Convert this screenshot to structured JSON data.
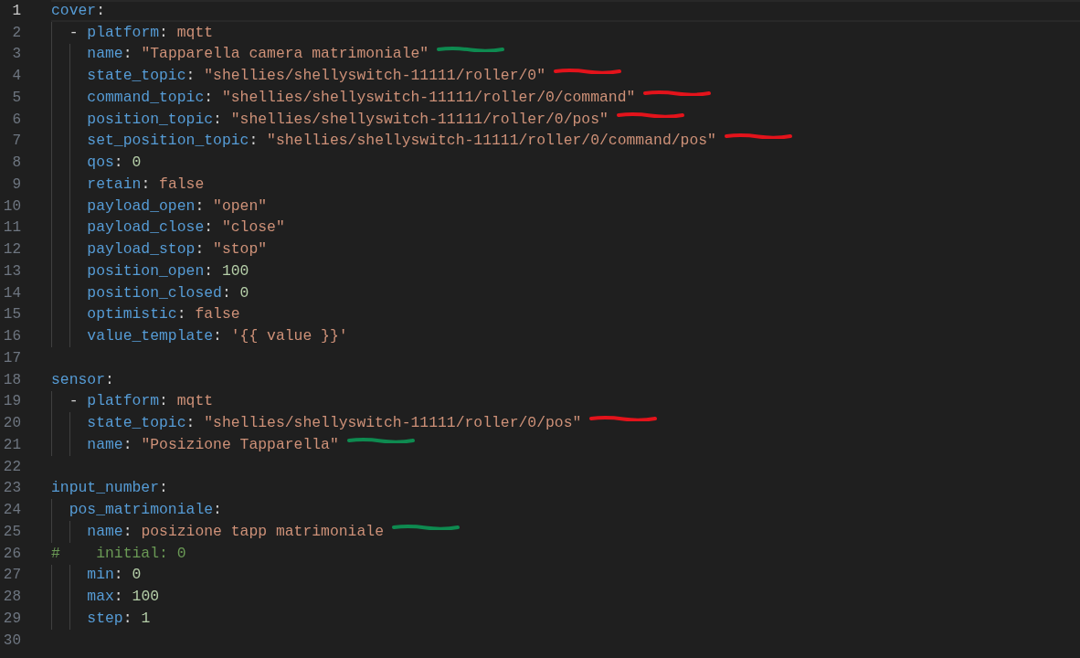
{
  "editor": {
    "lines": [
      {
        "number": "1",
        "current": true,
        "tokens": [
          {
            "kind": "key",
            "text": "cover"
          },
          {
            "kind": "punct",
            "text": ":"
          }
        ]
      },
      {
        "number": "2",
        "current": false,
        "tokens": [
          {
            "kind": "punct",
            "text": "  - "
          },
          {
            "kind": "key",
            "text": "platform"
          },
          {
            "kind": "punct",
            "text": ": "
          },
          {
            "kind": "string",
            "text": "mqtt"
          }
        ]
      },
      {
        "number": "3",
        "current": false,
        "mark": {
          "color": "#0e8a50"
        },
        "tokens": [
          {
            "kind": "key",
            "text": "    name"
          },
          {
            "kind": "punct",
            "text": ": "
          },
          {
            "kind": "string",
            "text": "\"Tapparella camera matrimoniale\""
          }
        ]
      },
      {
        "number": "4",
        "current": false,
        "mark": {
          "color": "#e3131b"
        },
        "tokens": [
          {
            "kind": "key",
            "text": "    state_topic"
          },
          {
            "kind": "punct",
            "text": ": "
          },
          {
            "kind": "string",
            "text": "\"shellies/shellyswitch-11111/roller/0\""
          }
        ]
      },
      {
        "number": "5",
        "current": false,
        "mark": {
          "color": "#e3131b"
        },
        "tokens": [
          {
            "kind": "key",
            "text": "    command_topic"
          },
          {
            "kind": "punct",
            "text": ": "
          },
          {
            "kind": "string",
            "text": "\"shellies/shellyswitch-11111/roller/0/command\""
          }
        ]
      },
      {
        "number": "6",
        "current": false,
        "mark": {
          "color": "#e3131b"
        },
        "tokens": [
          {
            "kind": "key",
            "text": "    position_topic"
          },
          {
            "kind": "punct",
            "text": ": "
          },
          {
            "kind": "string",
            "text": "\"shellies/shellyswitch-11111/roller/0/pos\""
          }
        ]
      },
      {
        "number": "7",
        "current": false,
        "mark": {
          "color": "#e3131b"
        },
        "tokens": [
          {
            "kind": "key",
            "text": "    set_position_topic"
          },
          {
            "kind": "punct",
            "text": ": "
          },
          {
            "kind": "string",
            "text": "\"shellies/shellyswitch-11111/roller/0/command/pos\""
          }
        ]
      },
      {
        "number": "8",
        "current": false,
        "tokens": [
          {
            "kind": "key",
            "text": "    qos"
          },
          {
            "kind": "punct",
            "text": ": "
          },
          {
            "kind": "number",
            "text": "0"
          }
        ]
      },
      {
        "number": "9",
        "current": false,
        "tokens": [
          {
            "kind": "key",
            "text": "    retain"
          },
          {
            "kind": "punct",
            "text": ": "
          },
          {
            "kind": "string",
            "text": "false"
          }
        ]
      },
      {
        "number": "10",
        "current": false,
        "tokens": [
          {
            "kind": "key",
            "text": "    payload_open"
          },
          {
            "kind": "punct",
            "text": ": "
          },
          {
            "kind": "string",
            "text": "\"open\""
          }
        ]
      },
      {
        "number": "11",
        "current": false,
        "tokens": [
          {
            "kind": "key",
            "text": "    payload_close"
          },
          {
            "kind": "punct",
            "text": ": "
          },
          {
            "kind": "string",
            "text": "\"close\""
          }
        ]
      },
      {
        "number": "12",
        "current": false,
        "tokens": [
          {
            "kind": "key",
            "text": "    payload_stop"
          },
          {
            "kind": "punct",
            "text": ": "
          },
          {
            "kind": "string",
            "text": "\"stop\""
          }
        ]
      },
      {
        "number": "13",
        "current": false,
        "tokens": [
          {
            "kind": "key",
            "text": "    position_open"
          },
          {
            "kind": "punct",
            "text": ": "
          },
          {
            "kind": "number",
            "text": "100"
          }
        ]
      },
      {
        "number": "14",
        "current": false,
        "tokens": [
          {
            "kind": "key",
            "text": "    position_closed"
          },
          {
            "kind": "punct",
            "text": ": "
          },
          {
            "kind": "number",
            "text": "0"
          }
        ]
      },
      {
        "number": "15",
        "current": false,
        "tokens": [
          {
            "kind": "key",
            "text": "    optimistic"
          },
          {
            "kind": "punct",
            "text": ": "
          },
          {
            "kind": "string",
            "text": "false"
          }
        ]
      },
      {
        "number": "16",
        "current": false,
        "tokens": [
          {
            "kind": "key",
            "text": "    value_template"
          },
          {
            "kind": "punct",
            "text": ": "
          },
          {
            "kind": "string",
            "text": "'{{ value }}'"
          }
        ]
      },
      {
        "number": "17",
        "current": false
      },
      {
        "number": "18",
        "current": false,
        "tokens": [
          {
            "kind": "key",
            "text": "sensor"
          },
          {
            "kind": "punct",
            "text": ":"
          }
        ]
      },
      {
        "number": "19",
        "current": false,
        "tokens": [
          {
            "kind": "punct",
            "text": "  - "
          },
          {
            "kind": "key",
            "text": "platform"
          },
          {
            "kind": "punct",
            "text": ": "
          },
          {
            "kind": "string",
            "text": "mqtt"
          }
        ]
      },
      {
        "number": "20",
        "current": false,
        "mark": {
          "color": "#e3131b"
        },
        "tokens": [
          {
            "kind": "key",
            "text": "    state_topic"
          },
          {
            "kind": "punct",
            "text": ": "
          },
          {
            "kind": "string",
            "text": "\"shellies/shellyswitch-11111/roller/0/pos\""
          }
        ]
      },
      {
        "number": "21",
        "current": false,
        "mark": {
          "color": "#0e8a50"
        },
        "tokens": [
          {
            "kind": "key",
            "text": "    name"
          },
          {
            "kind": "punct",
            "text": ": "
          },
          {
            "kind": "string",
            "text": "\"Posizione Tapparella\""
          }
        ]
      },
      {
        "number": "22",
        "current": false
      },
      {
        "number": "23",
        "current": false,
        "tokens": [
          {
            "kind": "key",
            "text": "input_number"
          },
          {
            "kind": "punct",
            "text": ":"
          }
        ]
      },
      {
        "number": "24",
        "current": false,
        "tokens": [
          {
            "kind": "key",
            "text": "  pos_matrimoniale"
          },
          {
            "kind": "punct",
            "text": ":"
          }
        ]
      },
      {
        "number": "25",
        "current": false,
        "mark": {
          "color": "#0e8a50"
        },
        "tokens": [
          {
            "kind": "key",
            "text": "    name"
          },
          {
            "kind": "punct",
            "text": ": "
          },
          {
            "kind": "string",
            "text": "posizione tapp matrimoniale"
          }
        ]
      },
      {
        "number": "26",
        "current": false,
        "tokens": [
          {
            "kind": "comment",
            "text": "#    initial: 0"
          }
        ]
      },
      {
        "number": "27",
        "current": false,
        "tokens": [
          {
            "kind": "key",
            "text": "    min"
          },
          {
            "kind": "punct",
            "text": ": "
          },
          {
            "kind": "number",
            "text": "0"
          }
        ]
      },
      {
        "number": "28",
        "current": false,
        "tokens": [
          {
            "kind": "key",
            "text": "    max"
          },
          {
            "kind": "punct",
            "text": ": "
          },
          {
            "kind": "number",
            "text": "100"
          }
        ]
      },
      {
        "number": "29",
        "current": false,
        "tokens": [
          {
            "kind": "key",
            "text": "    step"
          },
          {
            "kind": "punct",
            "text": ": "
          },
          {
            "kind": "number",
            "text": "1"
          }
        ]
      },
      {
        "number": "30",
        "current": false
      }
    ]
  }
}
